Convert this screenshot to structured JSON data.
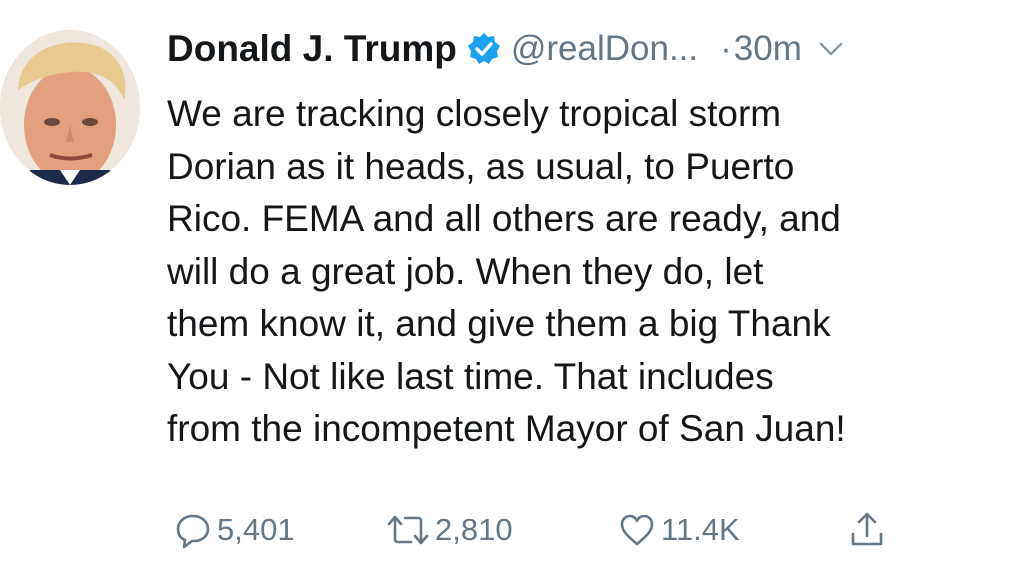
{
  "tweet": {
    "author_name": "Donald J. Trump",
    "handle": "@realDon...",
    "separator": "·",
    "time": "30m",
    "text_lines": [
      "We are tracking closely tropical storm",
      "Dorian as it heads, as usual, to Puerto",
      "Rico. FEMA and all others are ready,  and",
      "will do a great job. When they do, let",
      "them know it, and give them a big Thank",
      "You - Not like last time. That includes",
      "from the incompetent Mayor of San Juan!"
    ],
    "replies": "5,401",
    "retweets": "2,810",
    "likes": "11.4K"
  },
  "icons": {
    "verified": "verified-badge-icon",
    "caret": "chevron-down-icon",
    "reply": "reply-icon",
    "retweet": "retweet-icon",
    "like": "heart-icon",
    "share": "share-icon"
  },
  "colors": {
    "verified_blue": "#1da1f2",
    "secondary_text": "#657786",
    "primary_text": "#14171a"
  }
}
